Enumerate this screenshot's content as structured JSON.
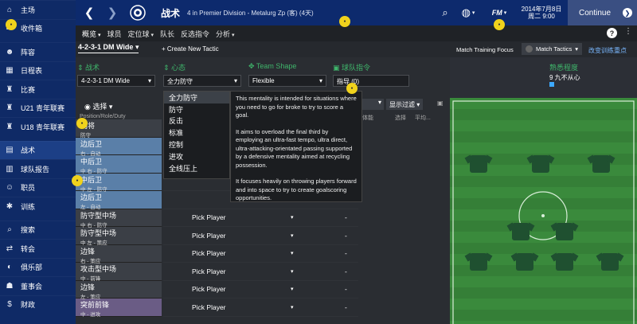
{
  "sidebar": {
    "items": [
      {
        "label": "主场",
        "icon": "home-icon",
        "glyph": "⌂"
      },
      {
        "label": "收件箱",
        "icon": "inbox-icon",
        "glyph": "✉"
      },
      {
        "label": "阵容",
        "icon": "squad-icon",
        "glyph": "☻"
      },
      {
        "label": "日程表",
        "icon": "calendar-icon",
        "glyph": "▦"
      },
      {
        "label": "比赛",
        "icon": "trophy-icon",
        "glyph": "♜"
      },
      {
        "label": "U21 青年联赛",
        "icon": "u21-icon",
        "glyph": "♜"
      },
      {
        "label": "U18 青年联赛",
        "icon": "u18-icon",
        "glyph": "♜"
      },
      {
        "label": "战术",
        "icon": "tactics-icon",
        "glyph": "▤"
      },
      {
        "label": "球队报告",
        "icon": "report-icon",
        "glyph": "▥"
      },
      {
        "label": "职员",
        "icon": "staff-icon",
        "glyph": "☺"
      },
      {
        "label": "训练",
        "icon": "training-icon",
        "glyph": "✱"
      },
      {
        "label": "搜索",
        "icon": "search-icon",
        "glyph": "⌕"
      },
      {
        "label": "转会",
        "icon": "transfer-icon",
        "glyph": "⇄"
      },
      {
        "label": "俱乐部",
        "icon": "club-icon",
        "glyph": "◐"
      },
      {
        "label": "董事会",
        "icon": "board-icon",
        "glyph": "☗"
      },
      {
        "label": "财政",
        "icon": "finance-icon",
        "glyph": "$"
      }
    ]
  },
  "topbar": {
    "title": "战术",
    "subtitle": "4 in Premier Division - Metalurg Zp (客) (4天)",
    "date_line1": "2014年7月8日",
    "date_line2": "周二 9:00",
    "continue_label": "Continue",
    "fm_label": "FM"
  },
  "subnav": [
    "概览",
    "球员",
    "定位球",
    "队长",
    "反选指令",
    "分析"
  ],
  "help_label": "?",
  "toolbar": {
    "formation": "4-2-3-1 DM Wide",
    "create_label": "+ Create New Tactic",
    "training_focus": "Match Training Focus",
    "match_tactics": "Match Tactics",
    "change_focus": "改变训练重点"
  },
  "columns": {
    "tactic": "战术",
    "mentality": "心态",
    "team_shape": "Team Shape",
    "team_instructions": "球队指令",
    "familiarity": "熟悉程度"
  },
  "selects": {
    "tactic": "4-2-3-1 DM Wide",
    "mentality": "全力防守",
    "shape": "Flexible",
    "instructions": "指导 (0)",
    "familiarity_text": "9 九不从心"
  },
  "player_list": {
    "select_label": "选择",
    "pos_header": "Position/Role/Duty",
    "filter_label": "显示过滤",
    "condition_header": "体能",
    "choice_header": "选择",
    "average_header": "平均..."
  },
  "rows": [
    {
      "role": "门将",
      "duty": "防守",
      "color": "gray"
    },
    {
      "role": "边后卫",
      "duty": "右 - 自动",
      "color": "blue"
    },
    {
      "role": "中后卫",
      "duty": "中 右 - 防守",
      "color": "blue"
    },
    {
      "role": "中后卫",
      "duty": "中 左 - 防守",
      "color": "blue"
    },
    {
      "role": "边后卫",
      "duty": "左 - 自动",
      "color": "blue"
    },
    {
      "role": "防守型中场",
      "duty": "中 右 - 防守",
      "color": "gray"
    },
    {
      "role": "防守型中场",
      "duty": "中 左 - 策应",
      "color": "gray"
    },
    {
      "role": "边锋",
      "duty": "右 - 策应",
      "color": "gray"
    },
    {
      "role": "攻击型中场",
      "duty": "中 - 前锋",
      "color": "gray"
    },
    {
      "role": "边锋",
      "duty": "左 - 策应",
      "color": "gray"
    },
    {
      "role": "突前前锋",
      "duty": "中 - 进攻",
      "color": "purple"
    }
  ],
  "pick_label": "Pick Player",
  "dash": "-",
  "mentality_menu": [
    "全力防守",
    "防守",
    "反击",
    "标准",
    "控制",
    "进攻",
    "全线压上"
  ],
  "tooltip": [
    "This mentality is intended for situations where you need to go for broke to try to score a goal.",
    "It aims to overload the final third by employing an ultra-fast tempo, ultra direct, ultra-attacking-orientated passing supported by a defensive mentality aimed at recycling possession.",
    "It focuses heavily on throwing players forward and into space to try to create goalscoring opportunities."
  ]
}
